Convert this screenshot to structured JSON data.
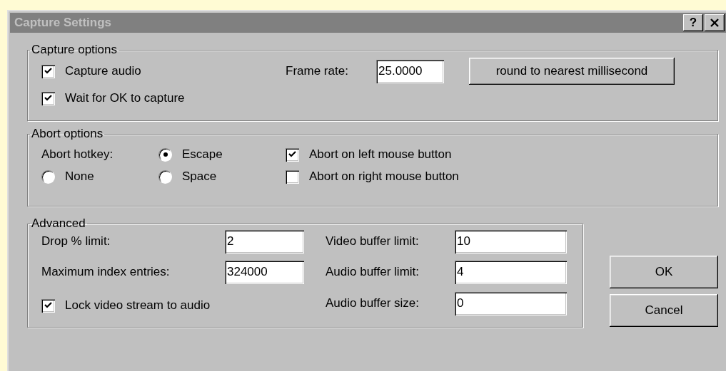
{
  "window": {
    "title": "Capture Settings",
    "help_button": "?"
  },
  "capture_options": {
    "title": "Capture options",
    "checkboxes": [
      {
        "label": "Capture audio",
        "checked": true
      },
      {
        "label": "Wait for OK to capture",
        "checked": true
      }
    ],
    "frame_rate": {
      "label": "Frame rate:",
      "value": "25.0000"
    },
    "round_button": "round to nearest millisecond"
  },
  "abort_options": {
    "title": "Abort options",
    "hotkey_label": "Abort hotkey:",
    "hotkeys": [
      {
        "label": "None",
        "selected": false
      },
      {
        "label": "Escape",
        "selected": true
      },
      {
        "label": "Space",
        "selected": false
      }
    ],
    "checkboxes": [
      {
        "label": "Abort on left mouse button",
        "checked": true
      },
      {
        "label": "Abort on right mouse button",
        "checked": false
      }
    ]
  },
  "advanced": {
    "title": "Advanced",
    "left_fields": [
      {
        "label": "Drop % limit:",
        "value": "2"
      },
      {
        "label": "Maximum index entries:",
        "value": "324000"
      }
    ],
    "lock_checkbox": {
      "label": "Lock video stream to audio",
      "checked": true
    },
    "right_fields": [
      {
        "label": "Video buffer limit:",
        "value": "10"
      },
      {
        "label": "Audio buffer limit:",
        "value": "4"
      },
      {
        "label": "Audio buffer size:",
        "value": "0"
      }
    ]
  },
  "buttons": [
    "OK",
    "Cancel"
  ]
}
